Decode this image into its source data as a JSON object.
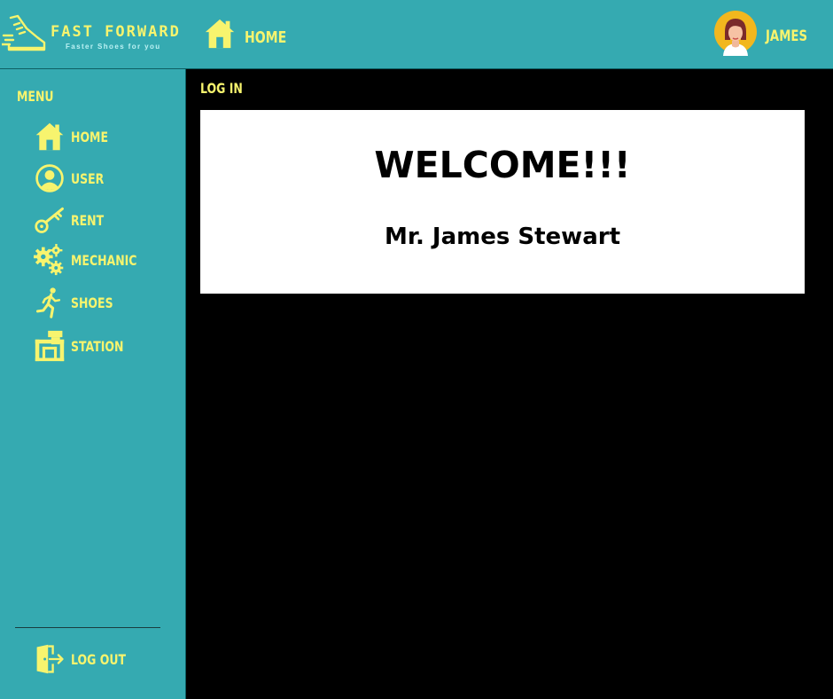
{
  "brand": {
    "name": "FAST FORWARD",
    "tagline": "Faster Shoes for you"
  },
  "header": {
    "nav_home_label": "HOME",
    "user_name": "JAMES"
  },
  "sidebar": {
    "menu_title": "MENU",
    "items": [
      {
        "label": "HOME",
        "icon": "home-icon"
      },
      {
        "label": "USER",
        "icon": "user-icon"
      },
      {
        "label": "RENT",
        "icon": "key-icon"
      },
      {
        "label": "MECHANIC",
        "icon": "gears-icon"
      },
      {
        "label": "SHOES",
        "icon": "runner-icon"
      },
      {
        "label": "STATION",
        "icon": "station-icon"
      }
    ],
    "logout_label": "LOG OUT"
  },
  "main": {
    "breadcrumb": "LOG IN",
    "welcome_title": "WELCOME!!!",
    "welcome_name": "Mr. James Stewart"
  },
  "colors": {
    "teal": "#35aab1",
    "accent_yellow": "#f7f46e",
    "background": "#000000",
    "card": "#ffffff"
  }
}
